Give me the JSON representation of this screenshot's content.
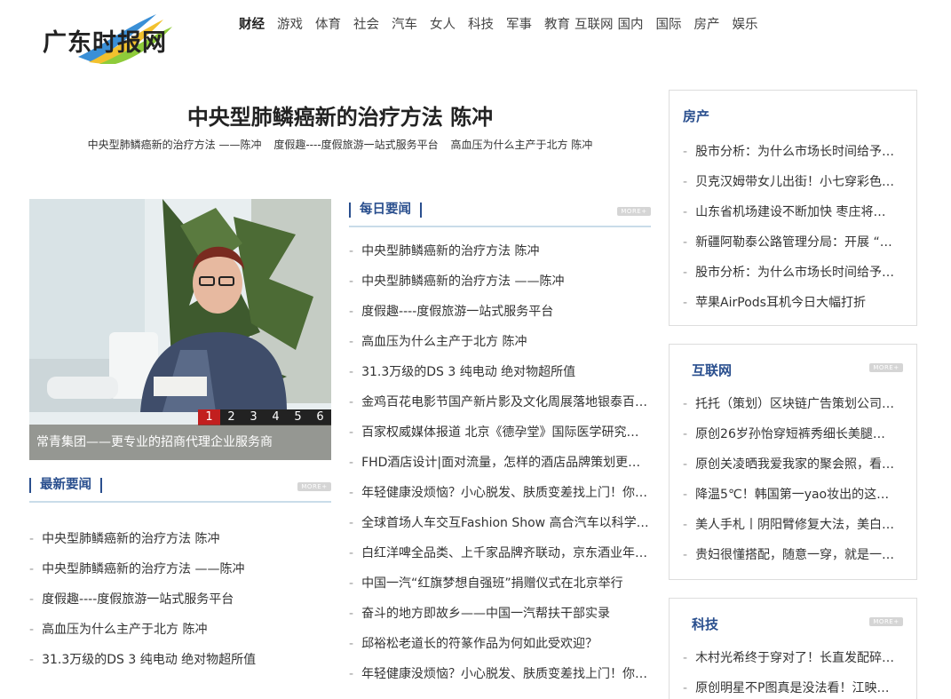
{
  "site": {
    "logo_text": "广东时报网"
  },
  "nav": [
    "财经",
    "游戏",
    "体育",
    "社会",
    "汽车",
    "女人",
    "科技",
    "军事",
    "教育",
    "互联网",
    "国内",
    "国际",
    "房产",
    "娱乐"
  ],
  "headline": "中央型肺鳞癌新的治疗方法 陈冲",
  "sublinks": [
    "中央型肺鳞癌新的治疗方法 ——陈冲",
    "度假趣----度假旅游一站式服务平台",
    "高血压为什么主产于北方 陈冲"
  ],
  "slideshow": {
    "numbers": [
      "1",
      "2",
      "3",
      "4",
      "5",
      "6"
    ],
    "active": 0,
    "caption": "常青集团——更专业的招商代理企业服务商"
  },
  "more_label": "MORE+",
  "latest": {
    "title": "最新要闻",
    "items": [
      "中央型肺鳞癌新的治疗方法 陈冲",
      "中央型肺鳞癌新的治疗方法 ——陈冲",
      "度假趣----度假旅游一站式服务平台",
      "高血压为什么主产于北方 陈冲",
      "31.3万级的DS 3 纯电动 绝对物超所值"
    ]
  },
  "daily": {
    "title": "每日要闻",
    "items": [
      "中央型肺鳞癌新的治疗方法 陈冲",
      "中央型肺鳞癌新的治疗方法 ——陈冲",
      "度假趣----度假旅游一站式服务平台",
      "高血压为什么主产于北方 陈冲",
      "31.3万级的DS 3 纯电动 绝对物超所值",
      "金鸡百花电影节国产新片影及文化周展落地银泰百…",
      "百家权威媒体报道 北京《德孕堂》国际医学研究…",
      "FHD酒店设计|面对流量，怎样的酒店品牌策划更能…",
      "年轻健康没烦恼？小心脱发、肤质变差找上门！你…",
      "全球首场人车交互Fashion Show 高合汽车以科学…",
      "白红洋啤全品类、上千家品牌齐联动，京东酒业年…",
      "中国一汽“红旗梦想自强班”捐赠仪式在北京举行",
      "奋斗的地方即故乡——中国一汽帮扶干部实录",
      "邱裕松老道长的符篆作品为何如此受欢迎？",
      "年轻健康没烦恼？小心脱发、肤质变差找上门！你…"
    ]
  },
  "right_boxes": [
    {
      "title": "房产",
      "has_more": false,
      "items": [
        "股市分析：为什么市场长时间给予…",
        "贝克汉姆带女儿出街！小七穿彩色…",
        "山东省机场建设不断加快 枣庄将建…",
        "新疆阿勒泰公路管理分局：开展 “…",
        "股市分析：为什么市场长时间给予…",
        "苹果AirPods耳机今日大幅打折"
      ]
    },
    {
      "title": "互联网",
      "has_more": true,
      "items": [
        "托托（策划）区块链广告策划公司…",
        "原创26岁孙怡穿短裤秀细长美腿，…",
        "原创关凌晒我爱我家的聚会照，看…",
        "降温5℃！韩国第一yao妆出的这款…",
        "美人手札丨阴阳臂修复大法，美白…",
        "贵妇很懂搭配，随意一穿，就是一…"
      ]
    },
    {
      "title": "科技",
      "has_more": true,
      "items": [
        "木村光希终于穿对了！长直发配碎…",
        "原创明星不P图真是没法看！江映蓉…"
      ]
    }
  ],
  "colors": {
    "accent": "#2a4f8e",
    "active_slide": "#c21f1f",
    "rule": "#c9dce9"
  }
}
